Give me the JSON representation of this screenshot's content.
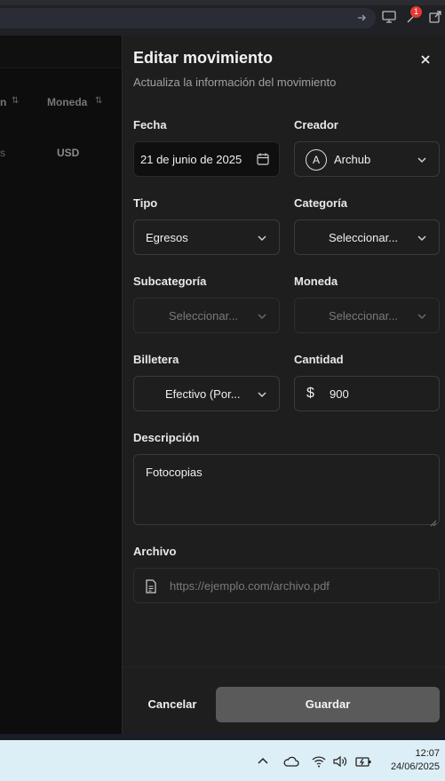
{
  "browser": {
    "notification_count": "1"
  },
  "background_table": {
    "col1_partial": "n",
    "col2_header": "Moneda",
    "sort_glyph": "⇅",
    "row_cell0_partial": "s",
    "row_currency": "USD"
  },
  "dialog": {
    "title": "Editar movimiento",
    "subtitle": "Actualiza la información del movimiento",
    "fields": {
      "fecha": {
        "label": "Fecha",
        "value": "21 de junio de 2025"
      },
      "creador": {
        "label": "Creador",
        "avatar_initial": "A",
        "value": "Archub"
      },
      "tipo": {
        "label": "Tipo",
        "value": "Egresos"
      },
      "categoria": {
        "label": "Categoría",
        "placeholder": "Seleccionar..."
      },
      "subcategoria": {
        "label": "Subcategoría",
        "placeholder": "Seleccionar..."
      },
      "moneda": {
        "label": "Moneda",
        "placeholder": "Seleccionar..."
      },
      "billetera": {
        "label": "Billetera",
        "value": "Efectivo (Por..."
      },
      "cantidad": {
        "label": "Cantidad",
        "currency_symbol": "$",
        "value": "900"
      },
      "descripcion": {
        "label": "Descripción",
        "value": "Fotocopias"
      },
      "archivo": {
        "label": "Archivo",
        "placeholder": "https://ejemplo.com/archivo.pdf"
      }
    },
    "buttons": {
      "cancel": "Cancelar",
      "save": "Guardar"
    }
  },
  "taskbar": {
    "time": "12:07",
    "date": "24/06/2025"
  },
  "colors": {
    "panel_bg": "#1e1e1e",
    "save_button": "#5a5a5a",
    "badge": "#e53935"
  }
}
